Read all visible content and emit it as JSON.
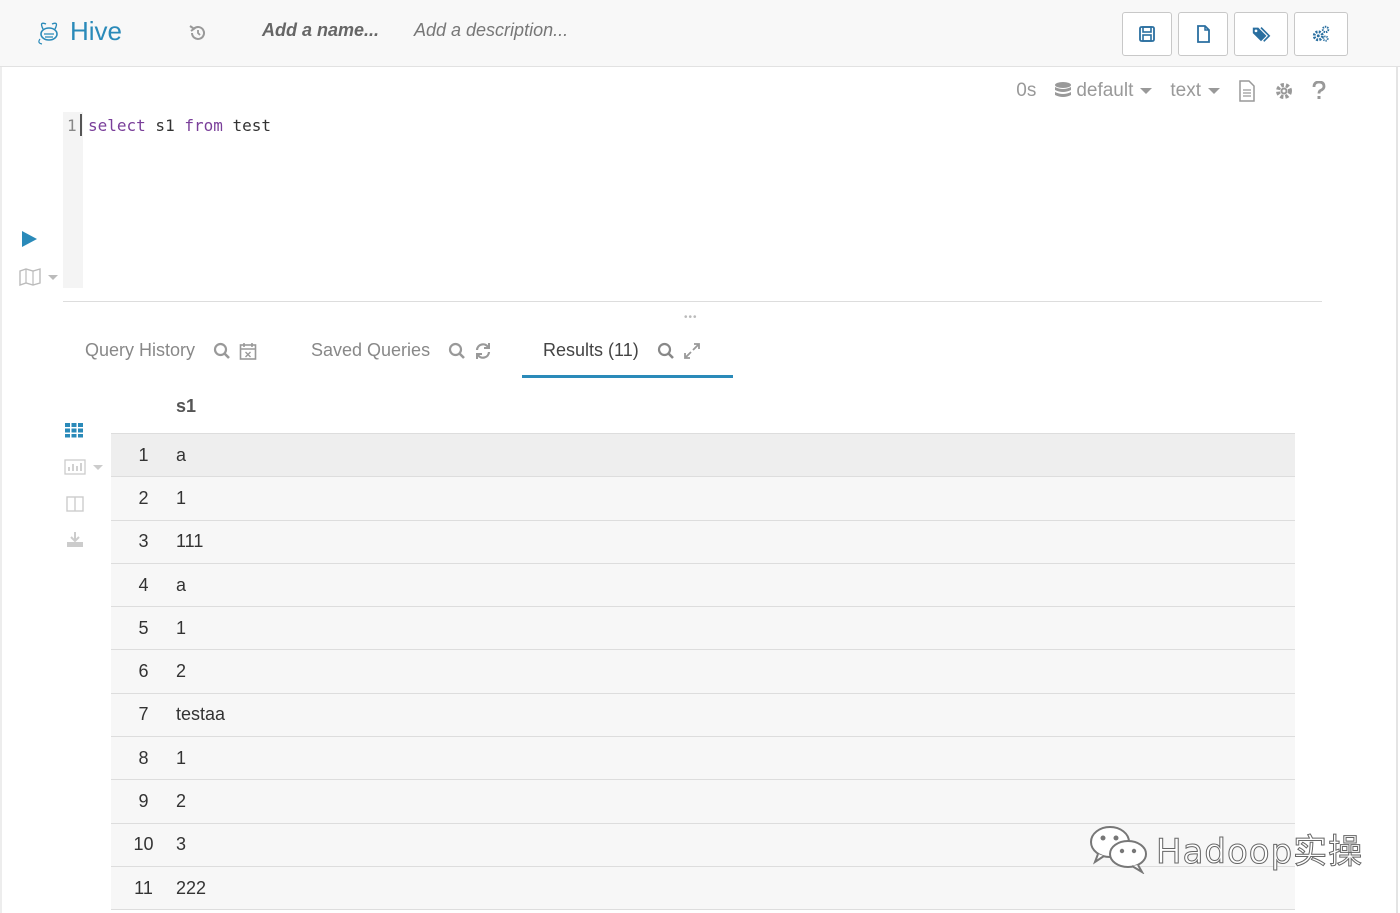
{
  "app": {
    "name": "Hive"
  },
  "header": {
    "name_placeholder": "Add a name...",
    "description_placeholder": "Add a description..."
  },
  "snippet": {
    "duration": "0s",
    "database": "default",
    "format": "text"
  },
  "editor": {
    "line_number": "1",
    "tokens": [
      "select",
      " s1 ",
      "from",
      " test"
    ]
  },
  "tabs": {
    "history": "Query History",
    "saved": "Saved Queries",
    "results": "Results (11)"
  },
  "results": {
    "column": "s1",
    "rows": [
      {
        "n": "1",
        "v": "a"
      },
      {
        "n": "2",
        "v": "1"
      },
      {
        "n": "3",
        "v": "111"
      },
      {
        "n": "4",
        "v": "a"
      },
      {
        "n": "5",
        "v": "1"
      },
      {
        "n": "6",
        "v": "2"
      },
      {
        "n": "7",
        "v": "testaa"
      },
      {
        "n": "8",
        "v": "1"
      },
      {
        "n": "9",
        "v": "2"
      },
      {
        "n": "10",
        "v": "3"
      },
      {
        "n": "11",
        "v": "222"
      }
    ]
  },
  "watermark": {
    "text": "Hadoop实操"
  },
  "colors": {
    "accent": "#2a8ab9",
    "keyword": "#7a3f9a"
  }
}
